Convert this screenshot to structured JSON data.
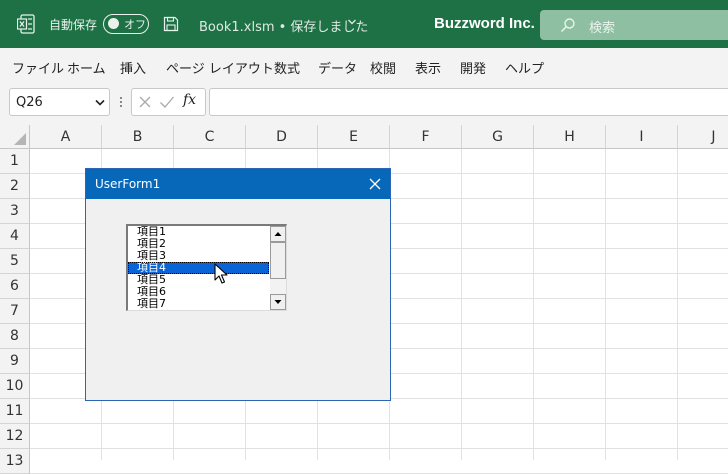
{
  "titlebar": {
    "autosave_label": "自動保存",
    "autosave_state": "オフ",
    "filename": "Book1.xlsm • 保存しました",
    "company": "Buzzword Inc.",
    "search_placeholder": "検索",
    "background_color": "#1e7145"
  },
  "menu": [
    "ファイル",
    "ホーム",
    "挿入",
    "ページ レイアウト",
    "数式",
    "データ",
    "校閲",
    "表示",
    "開発",
    "ヘルプ"
  ],
  "formula_bar": {
    "name_box": "Q26",
    "fx": "fx",
    "formula": ""
  },
  "columns": [
    "A",
    "B",
    "C",
    "D",
    "E",
    "F",
    "G",
    "H",
    "I",
    "J"
  ],
  "rows": [
    "1",
    "2",
    "3",
    "4",
    "5",
    "6",
    "7",
    "8",
    "9",
    "10",
    "11",
    "12",
    "13"
  ],
  "userform": {
    "title": "UserForm1",
    "title_color": "#0767b9",
    "listbox_items": [
      "項目1",
      "項目2",
      "項目3",
      "項目4",
      "項目5",
      "項目6",
      "項目7"
    ],
    "selected_index": 3,
    "selection_color": "#0a64d6"
  }
}
